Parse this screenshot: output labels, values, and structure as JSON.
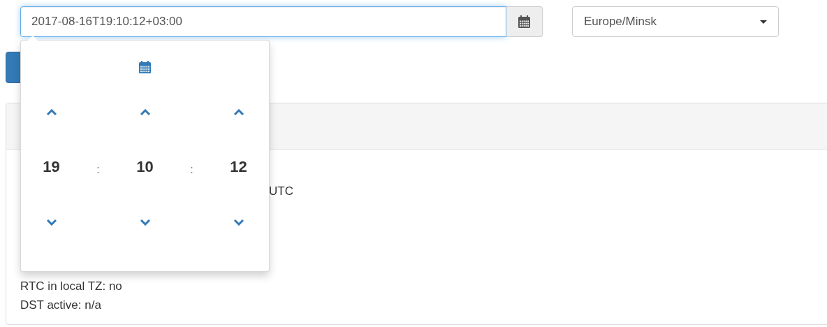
{
  "datetime_input": {
    "value": "2017-08-16T19:10:12+03:00",
    "focused": true
  },
  "timezone_select": {
    "value": "Europe/Minsk"
  },
  "time_picker": {
    "fields": [
      {
        "value": "19"
      },
      {
        "value": "10"
      },
      {
        "value": "12"
      }
    ],
    "separators": [
      ":",
      ":"
    ]
  },
  "info_panel": {
    "lines": [
      {
        "kind": "partial",
        "text": "UTC"
      },
      {
        "kind": "full",
        "text": "RTC in local TZ: no"
      },
      {
        "kind": "full",
        "text": "DST active: n/a"
      }
    ]
  }
}
